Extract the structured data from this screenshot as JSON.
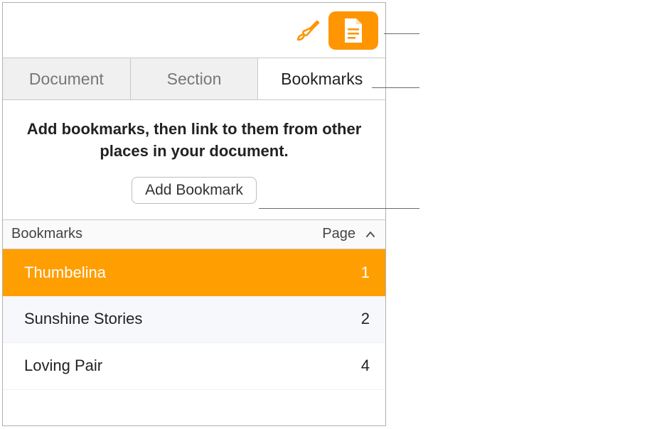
{
  "toolbar": {
    "brush_icon": "paintbrush-icon",
    "document_button": "document-icon"
  },
  "tabs": [
    {
      "label": "Document",
      "active": false
    },
    {
      "label": "Section",
      "active": false
    },
    {
      "label": "Bookmarks",
      "active": true
    }
  ],
  "instructions": "Add bookmarks, then link to them from other places in your document.",
  "add_button_label": "Add Bookmark",
  "list_header": {
    "name_col": "Bookmarks",
    "page_col": "Page"
  },
  "bookmarks": [
    {
      "name": "Thumbelina",
      "page": "1",
      "selected": true
    },
    {
      "name": "Sunshine Stories",
      "page": "2",
      "selected": false
    },
    {
      "name": "Loving Pair",
      "page": "4",
      "selected": false
    }
  ],
  "colors": {
    "accent": "#ff9500",
    "selection": "#ff9e00"
  }
}
